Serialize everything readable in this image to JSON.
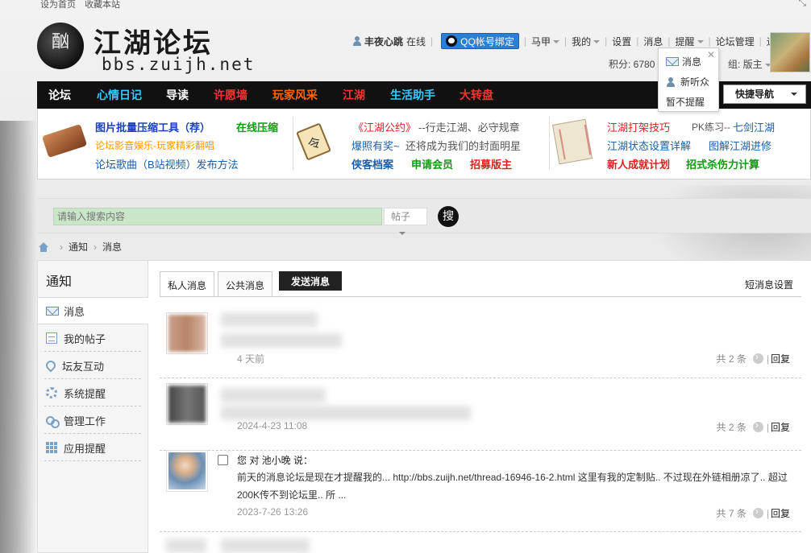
{
  "top_links": {
    "home": "设为首页",
    "fav": "收藏本站"
  },
  "logo": {
    "seal": "酗",
    "title": "江湖论坛",
    "url": "bbs.zuijh.net"
  },
  "user": {
    "name": "丰夜心跳",
    "status": "在线",
    "qq_bind": "QQ帐号绑定",
    "menu": [
      "马甲",
      "我的",
      "设置",
      "消息",
      "提醒",
      "论坛管理",
      "退出"
    ],
    "credits": "积分: 6780",
    "group": "组: 版主"
  },
  "notify_popup": {
    "message": "消息",
    "new_listener": "新听众",
    "no_remind": "暂不提醒"
  },
  "nav": {
    "items": [
      {
        "label": "论坛",
        "color": "#ffffff"
      },
      {
        "label": "心情日记",
        "color": "#33ccff"
      },
      {
        "label": "导读",
        "color": "#ffffff"
      },
      {
        "label": "许愿墙",
        "color": "#ff3333"
      },
      {
        "label": "玩家风采",
        "color": "#ff6600"
      },
      {
        "label": "江湖",
        "color": "#ff3333"
      },
      {
        "label": "生活助手",
        "color": "#33ccff"
      },
      {
        "label": "大转盘",
        "color": "#ff3333"
      }
    ],
    "quick_nav": "快捷导航"
  },
  "featured": {
    "col1": [
      {
        "text": "图片批量压缩工具（荐）",
        "color": "#1a3fbf"
      },
      {
        "text": "在线压缩",
        "color": "#119911"
      },
      {
        "text": "论坛影音娱乐-玩家精彩翻唱",
        "color": "#ff9900"
      },
      {
        "text": "论坛歌曲（B站视频）发布方法",
        "color": "#1a5fa8"
      }
    ],
    "col2": [
      {
        "text": "《江湖公约》",
        "color": "#e02020"
      },
      {
        "text": "--行走江湖、必守规章",
        "color": "#555555"
      },
      {
        "text": "爆照有奖~",
        "color": "#1a5fa8"
      },
      {
        "text": "还将成为我们的封面明星",
        "color": "#555555"
      },
      {
        "text": "侠客档案",
        "color": "#1a5fa8"
      },
      {
        "text": "申请会员",
        "color": "#119911"
      },
      {
        "text": "招募版主",
        "color": "#e02020"
      }
    ],
    "col3": [
      {
        "text": "江湖打架技巧",
        "color": "#e02020"
      },
      {
        "text": "PK练习--",
        "color": "#555555"
      },
      {
        "text": "七剑江湖",
        "color": "#1a5fa8"
      },
      {
        "text": "江湖状态设置详解",
        "color": "#1a5fa8"
      },
      {
        "text": "图解江湖进修",
        "color": "#1a5fa8"
      },
      {
        "text": "新人成就计划",
        "color": "#e02020"
      },
      {
        "text": "招式杀伤力计算",
        "color": "#119911"
      }
    ]
  },
  "search": {
    "placeholder": "请输入搜索内容",
    "type": "帖子",
    "button": "搜"
  },
  "breadcrumb": [
    "通知",
    "消息"
  ],
  "sidebar": {
    "title": "通知",
    "items": [
      {
        "label": "消息",
        "icon": "mail-icon"
      },
      {
        "label": "我的帖子",
        "icon": "document-icon"
      },
      {
        "label": "坛友互动",
        "icon": "interaction-icon"
      },
      {
        "label": "系统提醒",
        "icon": "gear-icon"
      },
      {
        "label": "管理工作",
        "icon": "link-icon"
      },
      {
        "label": "应用提醒",
        "icon": "grid-icon"
      }
    ]
  },
  "main": {
    "tabs": [
      "私人消息",
      "公共消息",
      "发送消息"
    ],
    "settings_link": "短消息设置",
    "messages": [
      {
        "time": "4 天前",
        "count": "共 2 条",
        "reply": "回复"
      },
      {
        "time": "2024-4-23 11:08",
        "count": "共 2 条",
        "reply": "回复"
      },
      {
        "sender": "您 对 池小晚 说：",
        "body": "前天的消息论坛是现在才提醒我的... http://bbs.zuijh.net/thread-16946-16-2.html 这里有我的定制贴.. 不过现在外链相册凉了.. 超过200K传不到论坛里.. 所 ...",
        "time": "2023-7-26 13:26",
        "count": "共 7 条",
        "reply": "回复"
      }
    ]
  }
}
